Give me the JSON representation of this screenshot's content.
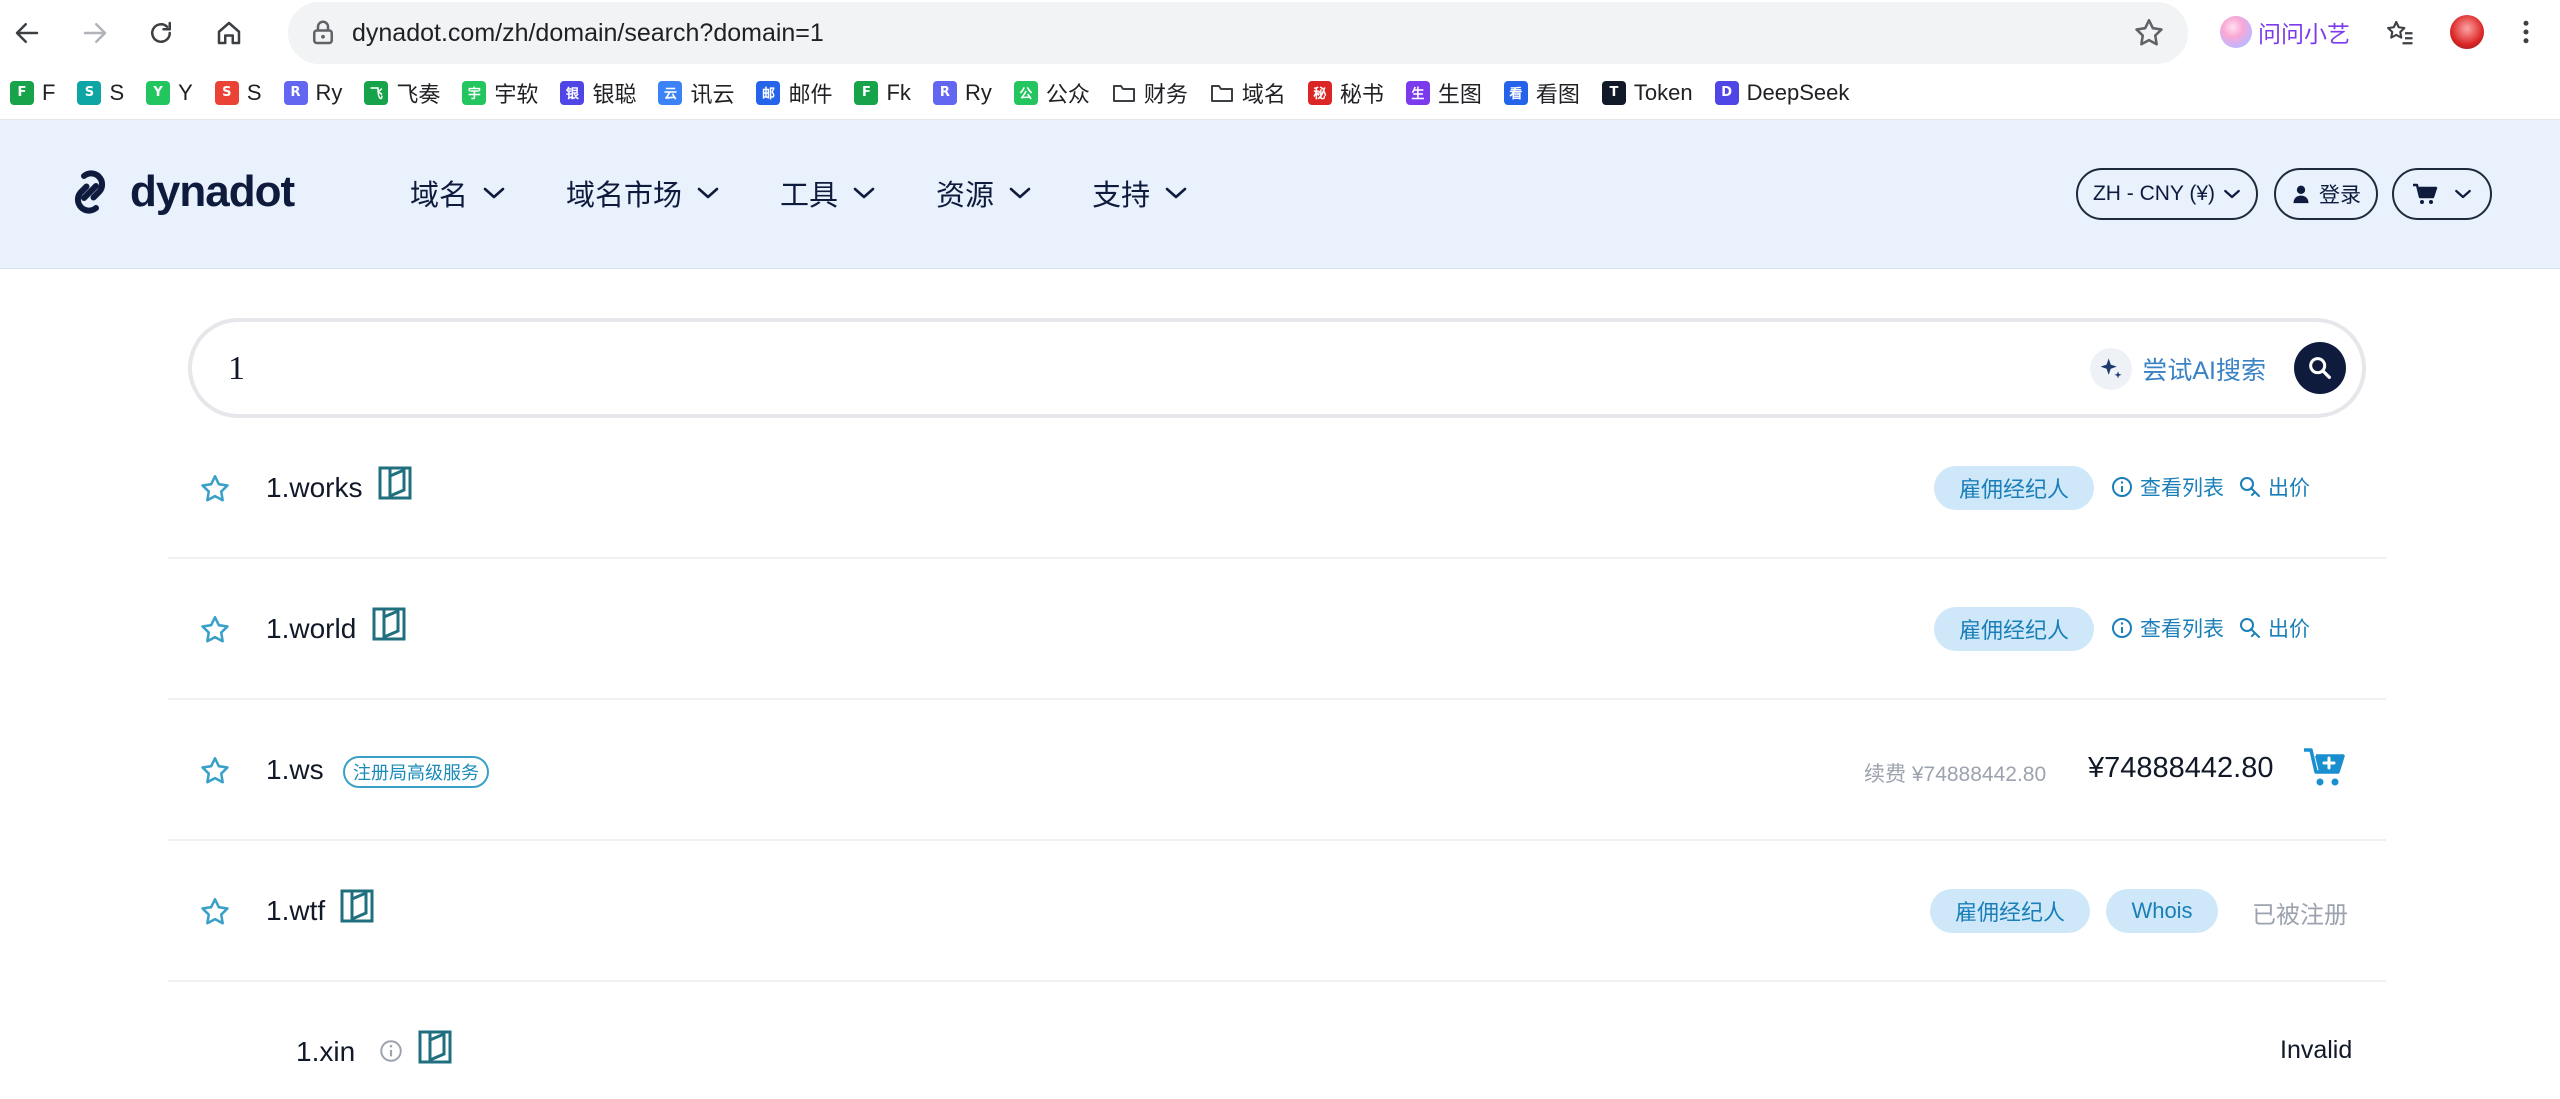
{
  "browser": {
    "url": "dynadot.com/zh/domain/search?domain=1",
    "assistant_label": "问问小艺"
  },
  "bookmarks": [
    {
      "label": "F",
      "icon_color": "#16a34a",
      "icon_text": "F"
    },
    {
      "label": "S",
      "icon_color": "#0ea5a5",
      "icon_text": "S"
    },
    {
      "label": "Y",
      "icon_color": "#22c55e",
      "icon_text": "Y"
    },
    {
      "label": "S",
      "icon_color": "#ea4335",
      "icon_text": "S"
    },
    {
      "label": "Ry",
      "icon_color": "#6366f1",
      "icon_text": "R"
    },
    {
      "label": "飞奏",
      "icon_color": "#16a34a",
      "icon_text": "飞"
    },
    {
      "label": "宇软",
      "icon_color": "#22c55e",
      "icon_text": "宇"
    },
    {
      "label": "银聪",
      "icon_color": "#4f46e5",
      "icon_text": "银"
    },
    {
      "label": "讯云",
      "icon_color": "#3b82f6",
      "icon_text": "云"
    },
    {
      "label": "邮件",
      "icon_color": "#2563eb",
      "icon_text": "邮"
    },
    {
      "label": "Fk",
      "icon_color": "#16a34a",
      "icon_text": "F"
    },
    {
      "label": "Ry",
      "icon_color": "#6366f1",
      "icon_text": "R"
    },
    {
      "label": "公众",
      "icon_color": "#22c55e",
      "icon_text": "公"
    },
    {
      "label": "财务",
      "icon_color": "#ffffff",
      "icon_text": "",
      "folder": true
    },
    {
      "label": "域名",
      "icon_color": "#ffffff",
      "icon_text": "",
      "folder": true
    },
    {
      "label": "秘书",
      "icon_color": "#dc2626",
      "icon_text": "秘"
    },
    {
      "label": "生图",
      "icon_color": "#7c3aed",
      "icon_text": "生"
    },
    {
      "label": "看图",
      "icon_color": "#2563eb",
      "icon_text": "看"
    },
    {
      "label": "Token",
      "icon_color": "#111827",
      "icon_text": "T"
    },
    {
      "label": "DeepSeek",
      "icon_color": "#4f46e5",
      "icon_text": "D"
    }
  ],
  "site": {
    "brand": "dynadot",
    "menu": [
      "域名",
      "域名市场",
      "工具",
      "资源",
      "支持"
    ],
    "currency": "ZH - CNY (¥)",
    "login": "登录"
  },
  "search": {
    "value": "1",
    "ai_label": "尝试AI搜索"
  },
  "results": [
    {
      "domain": "1.works",
      "broker": "雇佣经纪人",
      "view_listing": "查看列表",
      "offer": "出价"
    },
    {
      "domain": "1.world",
      "broker": "雇佣经纪人",
      "view_listing": "查看列表",
      "offer": "出价"
    },
    {
      "domain": "1.ws",
      "premium_tag": "注册局高级服务",
      "renew": "续费 ¥74888442.80",
      "price": "¥74888442.80"
    },
    {
      "domain": "1.wtf",
      "broker": "雇佣经纪人",
      "whois": "Whois",
      "status": "已被注册"
    },
    {
      "domain": "1.xin",
      "status": "Invalid"
    }
  ],
  "colors": {
    "header_bg": "#e8f1fc",
    "brand_navy": "#0f1b3d",
    "link_blue": "#1a7fb8",
    "chip_bg": "#cfe8f9"
  }
}
